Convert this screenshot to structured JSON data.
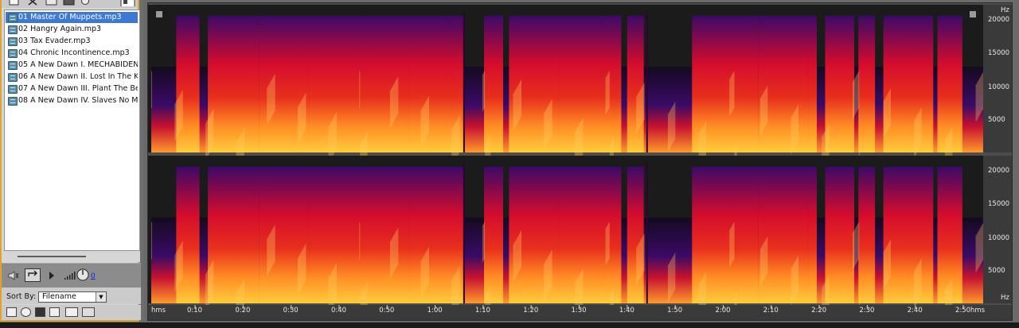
{
  "file_panel": {
    "files": [
      {
        "label": "01 Master Of Muppets.mp3",
        "selected": true
      },
      {
        "label": "02 Hangry Again.mp3",
        "selected": false
      },
      {
        "label": "03 Tax Evader.mp3",
        "selected": false
      },
      {
        "label": "04 Chronic Incontinence.mp3",
        "selected": false
      },
      {
        "label": "05 A New Dawn I. MECHABIDEN",
        "selected": false
      },
      {
        "label": "06 A New Dawn II. Lost In The K",
        "selected": false
      },
      {
        "label": "07 A New Dawn III. Plant The Be",
        "selected": false
      },
      {
        "label": "08 A New Dawn IV. Slaves No M",
        "selected": false
      }
    ],
    "volume_value": "0",
    "sort_by_label": "Sort By:",
    "sort_by_value": "Filename",
    "toolbar_icons": [
      "open-file-icon",
      "close-file-icon",
      "insert-icon",
      "grid-icon",
      "clock-icon",
      "window-icon"
    ],
    "transport_icons": [
      "speaker-icon",
      "loop-icon",
      "play-icon",
      "volume-knob-icon"
    ],
    "bottom_icons": [
      "film-icon",
      "cd-icon",
      "frame-icon",
      "audio-icon",
      "filter-icon",
      "tag-icon"
    ]
  },
  "spectral_view": {
    "time_unit": "hms",
    "time_ticks": [
      "0:10",
      "0:20",
      "0:30",
      "0:40",
      "0:50",
      "1:00",
      "1:10",
      "1:20",
      "1:30",
      "1:40",
      "1:50",
      "2:00",
      "2:10",
      "2:20",
      "2:30",
      "2:40",
      "2:50"
    ],
    "freq_unit": "Hz",
    "freq_ticks": [
      "20000",
      "15000",
      "10000",
      "5000"
    ],
    "channels": 2,
    "colors": {
      "bg": "#1b1b1b",
      "low": "#3b0a66",
      "mid": "#d40c2d",
      "high": "#ffcd3a",
      "accent": "#e0a22a"
    }
  }
}
